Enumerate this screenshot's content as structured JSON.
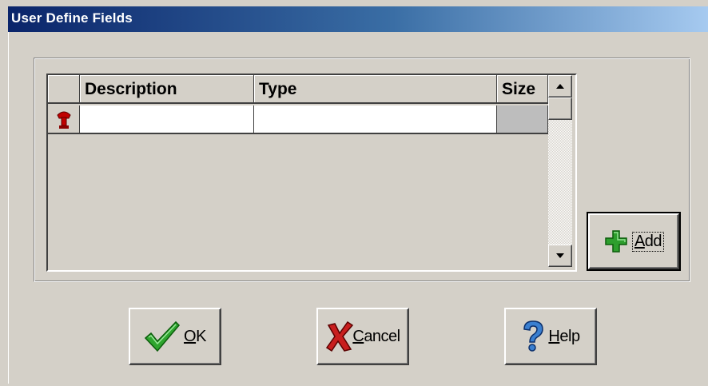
{
  "window": {
    "title": "User Define Fields"
  },
  "grid": {
    "columns": [
      "Description",
      "Type",
      "Size"
    ],
    "rows": [
      {
        "description": "",
        "type": "",
        "size": ""
      }
    ]
  },
  "buttons": {
    "add": {
      "label": "Add",
      "mnemonic": "A",
      "rest": "dd",
      "icon": "green-plus-icon"
    },
    "ok": {
      "label": "OK",
      "mnemonic": "O",
      "rest": "K",
      "icon": "green-checkmark-icon"
    },
    "cancel": {
      "label": "Cancel",
      "mnemonic": "C",
      "rest": "ancel",
      "icon": "red-x-icon"
    },
    "help": {
      "label": "Help",
      "mnemonic": "H",
      "rest": "elp",
      "icon": "blue-question-icon"
    }
  },
  "colors": {
    "title_start": "#0a246a",
    "title_end": "#a6caf0",
    "face": "#d4d0c8"
  }
}
